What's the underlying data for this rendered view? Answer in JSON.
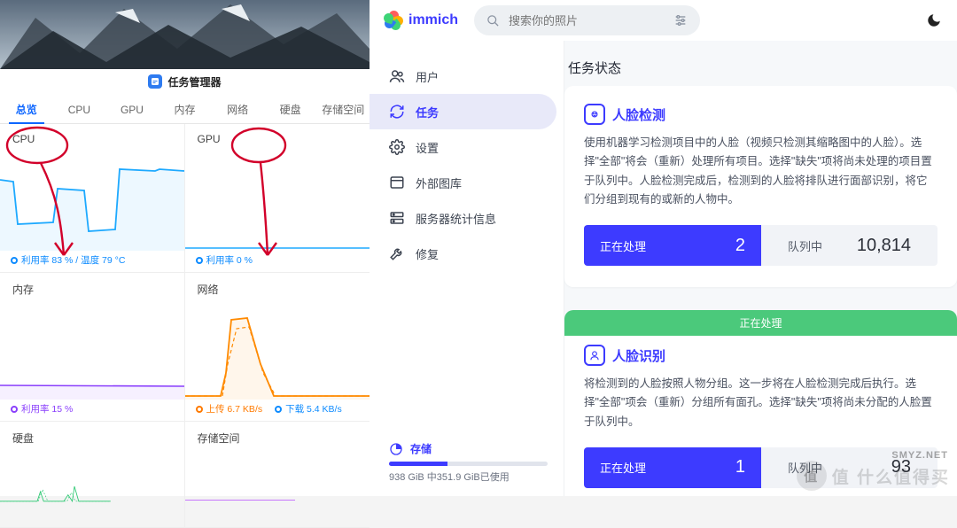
{
  "taskManager": {
    "title": "任务管理器",
    "tabs": [
      "总览",
      "CPU",
      "GPU",
      "内存",
      "网络",
      "硬盘",
      "存储空间"
    ],
    "activeTab": 0,
    "cpu": {
      "title": "CPU",
      "legend": "利用率 83 % / 温度 79 °C"
    },
    "gpu": {
      "title": "GPU",
      "legend": "利用率 0 %"
    },
    "mem": {
      "title": "内存",
      "legend": "利用率 15 %"
    },
    "net": {
      "title": "网络",
      "upload": "上传 6.7 KB/s",
      "download": "下载 5.4 KB/s"
    },
    "disk": {
      "title": "硬盘"
    },
    "store": {
      "title": "存储空间"
    }
  },
  "immich": {
    "brand": "immich",
    "search": {
      "placeholder": "搜索你的照片"
    },
    "sidebar": {
      "items": [
        {
          "label": "用户",
          "icon": "users-icon"
        },
        {
          "label": "任务",
          "icon": "refresh-icon"
        },
        {
          "label": "设置",
          "icon": "gear-icon"
        },
        {
          "label": "外部图库",
          "icon": "library-icon"
        },
        {
          "label": "服务器统计信息",
          "icon": "server-icon"
        },
        {
          "label": "修复",
          "icon": "wrench-icon"
        }
      ],
      "active": 1
    },
    "storage": {
      "label": "存储",
      "text": "938 GiB 中351.9 GiB已使用",
      "percent": 37
    },
    "pageTitle": "任务状态",
    "bannerText": "正在处理",
    "jobs": [
      {
        "icon": "face-detect-icon",
        "title": "人脸检测",
        "desc": "使用机器学习检测项目中的人脸（视频只检测其缩略图中的人脸）。选择\"全部\"将会（重新）处理所有项目。选择\"缺失\"项将尚未处理的项目置于队列中。人脸检测完成后，检测到的人脸将排队进行面部识别，将它们分组到现有的或新的人物中。",
        "activeLabel": "正在处理",
        "activeCount": "2",
        "queueLabel": "队列中",
        "queueCount": "10,814"
      },
      {
        "icon": "face-recog-icon",
        "title": "人脸识别",
        "desc": "将检测到的人脸按照人物分组。这一步将在人脸检测完成后执行。选择\"全部\"项会（重新）分组所有面孔。选择\"缺失\"项将尚未分配的人脸置于队列中。",
        "activeLabel": "正在处理",
        "activeCount": "1",
        "queueLabel": "队列中",
        "queueCount": "93"
      }
    ]
  },
  "watermark": {
    "smyz": "SMYZ.NET",
    "text": "值 什么值得买",
    "badge": "值"
  }
}
